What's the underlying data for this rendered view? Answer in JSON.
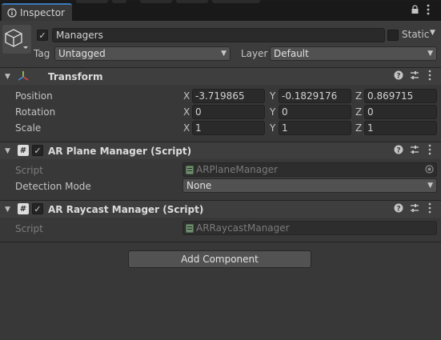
{
  "tab": {
    "label": "Inspector"
  },
  "gameobject": {
    "name": "Managers",
    "active": true,
    "static_label": "Static",
    "tag_label": "Tag",
    "tag_value": "Untagged",
    "layer_label": "Layer",
    "layer_value": "Default"
  },
  "transform": {
    "title": "Transform",
    "position_label": "Position",
    "rotation_label": "Rotation",
    "scale_label": "Scale",
    "axis_x": "X",
    "axis_y": "Y",
    "axis_z": "Z",
    "position": [
      "-3.719865",
      "-0.1829176",
      "0.869715"
    ],
    "rotation": [
      "0",
      "0",
      "0"
    ],
    "scale": [
      "1",
      "1",
      "1"
    ]
  },
  "ar_plane_manager": {
    "title": "AR Plane Manager (Script)",
    "enabled": true,
    "script_label": "Script",
    "script_value": "ARPlaneManager",
    "detection_label": "Detection Mode",
    "detection_value": "None"
  },
  "ar_raycast_manager": {
    "title": "AR Raycast Manager (Script)",
    "enabled": true,
    "script_label": "Script",
    "script_value": "ARRaycastManager"
  },
  "add_component": {
    "label": "Add Component"
  },
  "icons": {
    "tab": "inspector-icon",
    "lock": "lock-icon",
    "menu": "kebab-menu-icon",
    "help": "help-icon",
    "preset": "preset-icon",
    "script": "script-icon",
    "target": "object-picker-icon"
  },
  "colors": {
    "accent": "#3a79bb",
    "background": "#383838"
  }
}
